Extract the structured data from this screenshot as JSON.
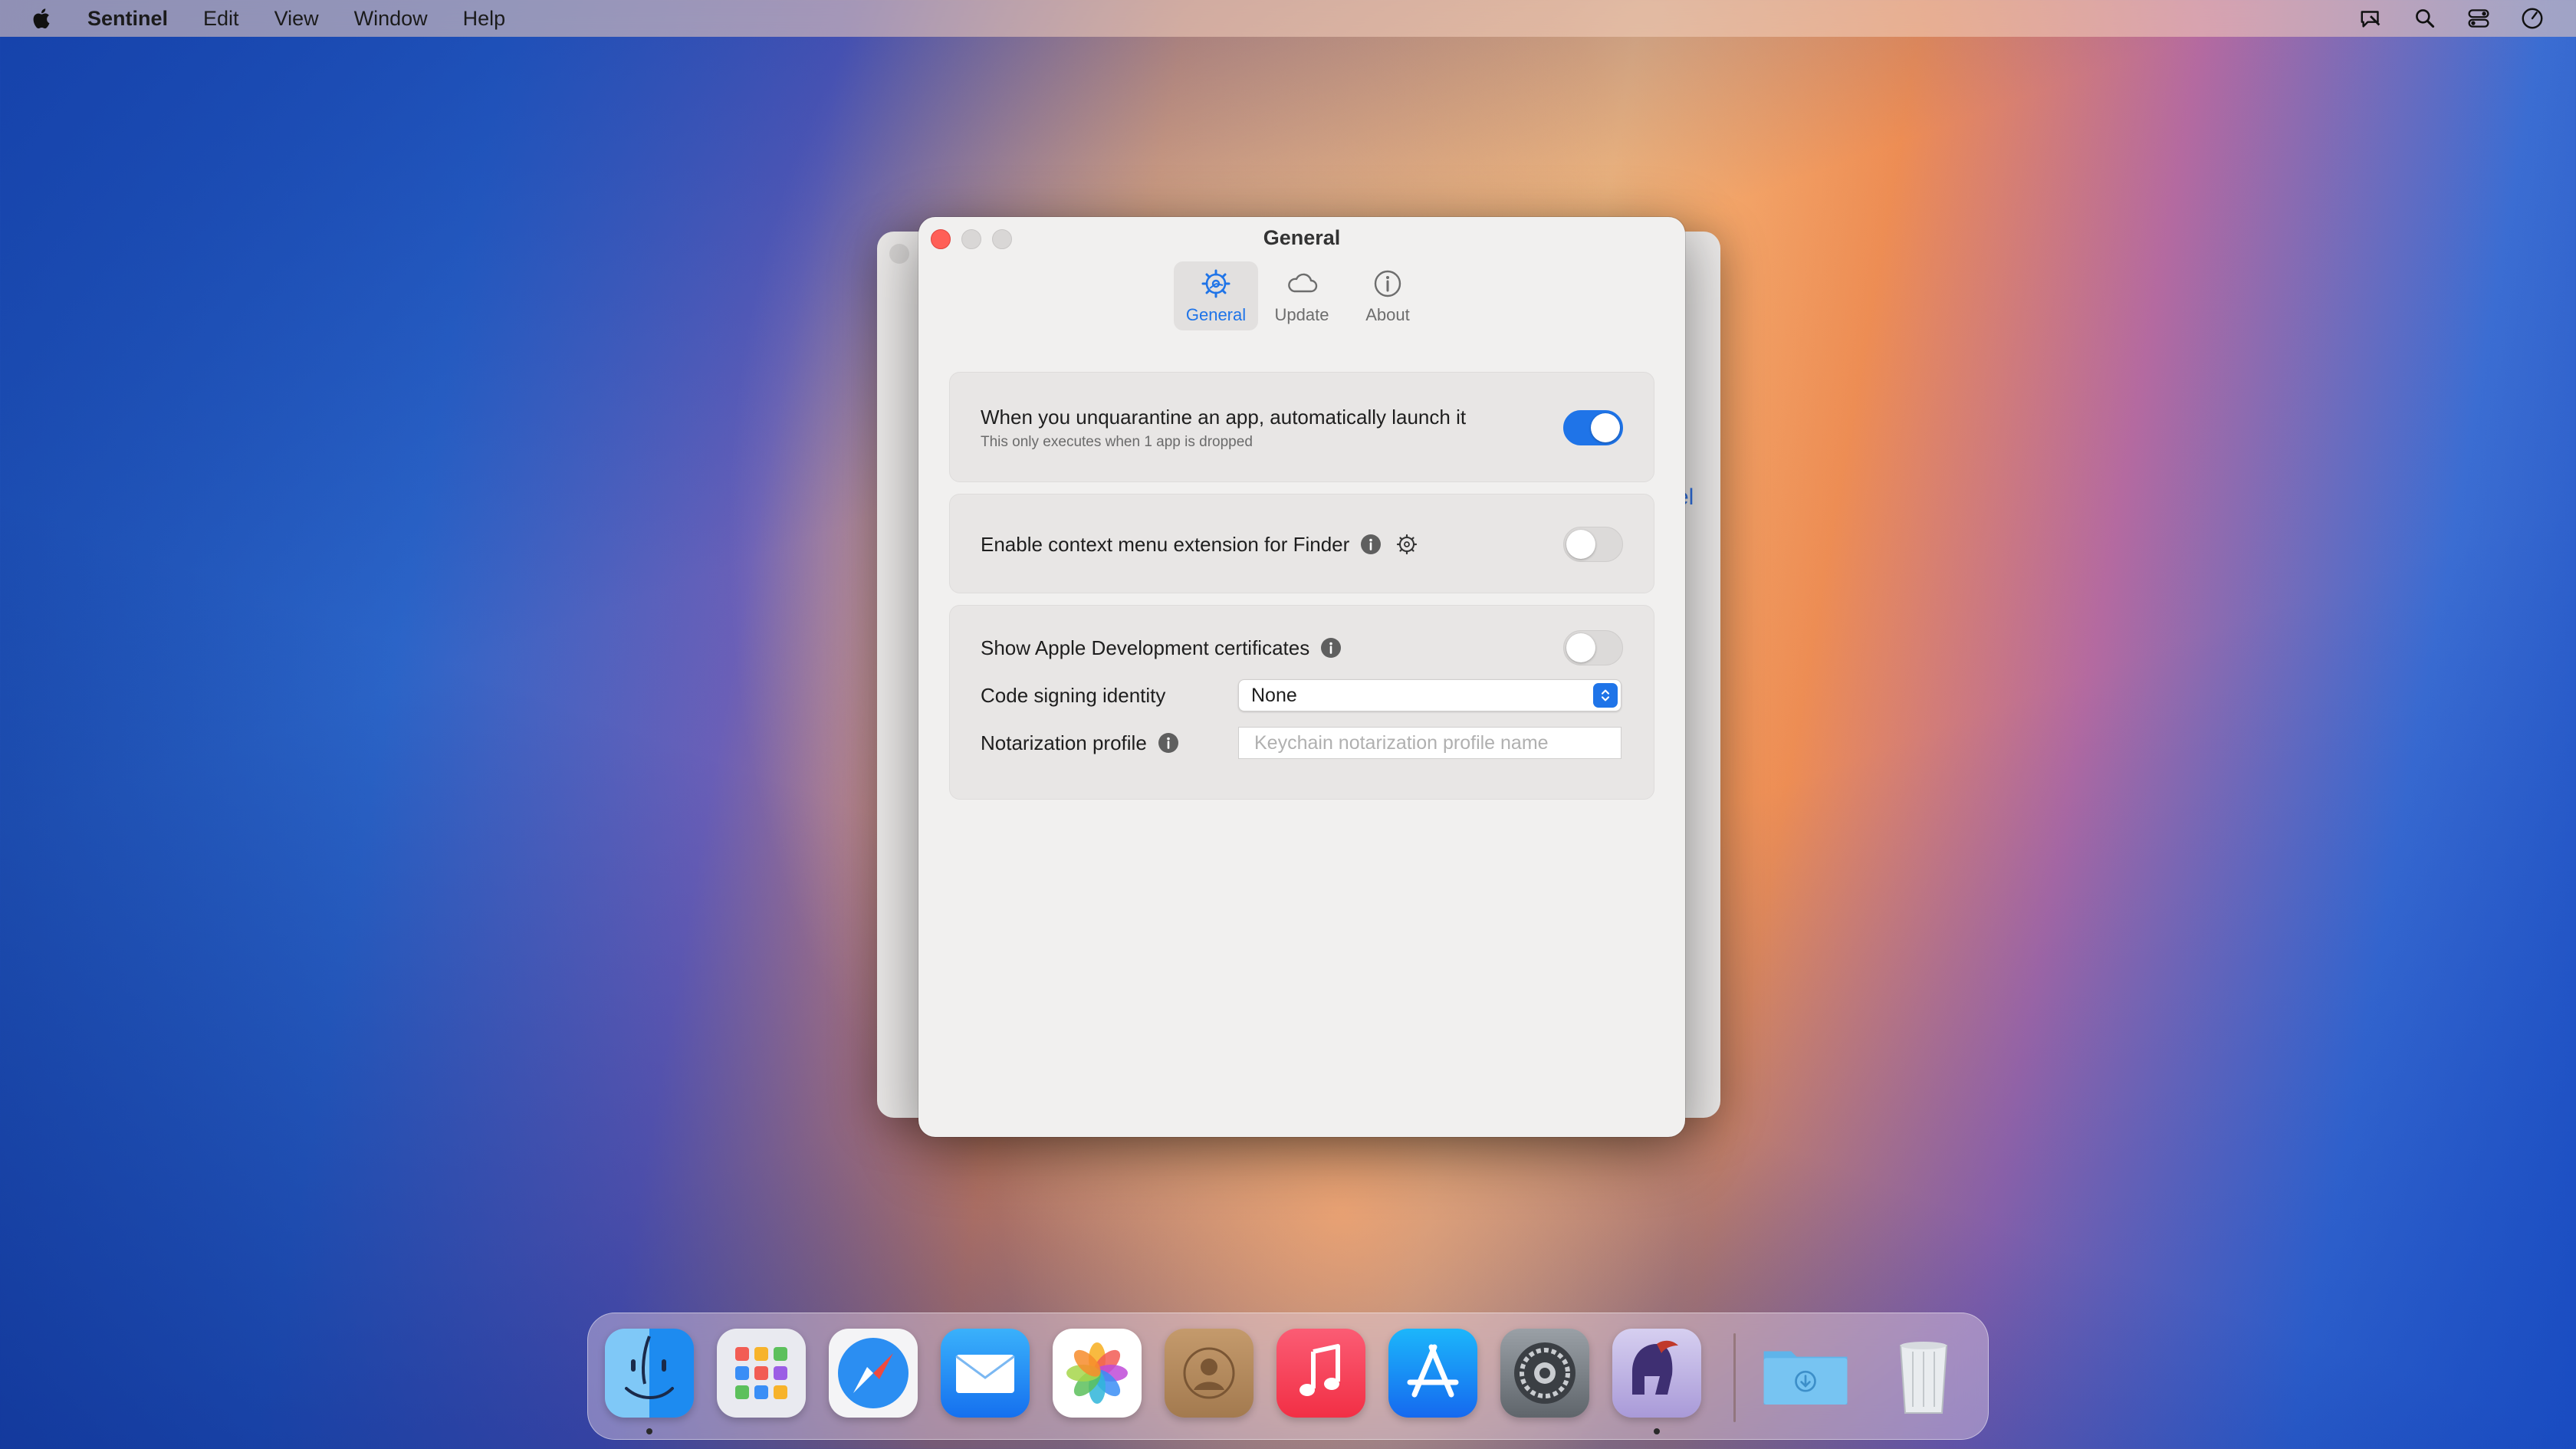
{
  "menubar": {
    "app_name": "Sentinel",
    "items": [
      "Edit",
      "View",
      "Window",
      "Help"
    ]
  },
  "window": {
    "title": "General",
    "tabs": [
      {
        "label": "General",
        "icon": "gear-icon",
        "active": true
      },
      {
        "label": "Update",
        "icon": "cloud-icon",
        "active": false
      },
      {
        "label": "About",
        "icon": "info-circle-icon",
        "active": false
      }
    ],
    "auto_launch": {
      "label": "When you unquarantine an app, automatically launch it",
      "sublabel": "This only executes when 1 app is dropped",
      "enabled": true
    },
    "context_menu": {
      "label": "Enable context menu extension for Finder",
      "enabled": false
    },
    "certs": {
      "label": "Show Apple Development certificates",
      "enabled": false
    },
    "code_signing": {
      "label": "Code signing identity",
      "value": "None"
    },
    "notarization": {
      "label": "Notarization profile",
      "placeholder": "Keychain notarization profile name"
    }
  },
  "back_window": {
    "edge_text": "el"
  },
  "dock": {
    "apps": [
      "Finder",
      "Launchpad",
      "Safari",
      "Mail",
      "Photos",
      "Contacts",
      "Music",
      "App Store",
      "System Settings",
      "Sentinel",
      "Downloads",
      "Trash"
    ]
  },
  "colors": {
    "accent": "#1f74e8",
    "close": "#ff5f57"
  }
}
